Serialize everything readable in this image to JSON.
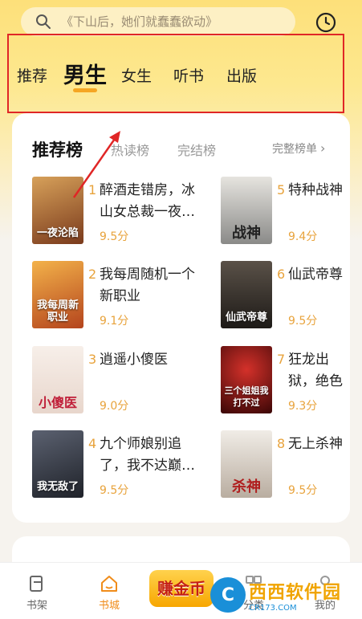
{
  "search": {
    "placeholder": "《下山后，她们就蠢蠢欲动》"
  },
  "tabs": [
    {
      "label": "推荐"
    },
    {
      "label": "男生"
    },
    {
      "label": "女生"
    },
    {
      "label": "听书"
    },
    {
      "label": "出版"
    }
  ],
  "active_tab": "男生",
  "rank": {
    "tabs": [
      {
        "label": "推荐榜"
      },
      {
        "label": "热读榜"
      },
      {
        "label": "完结榜"
      }
    ],
    "full_list": "完整榜单",
    "books": [
      {
        "rank": "1",
        "title": "醉酒走错房，冰山女总裁一夜…",
        "score": "9.5分",
        "cover_text": "一夜沦陷",
        "cover_color": "#7a3a1c"
      },
      {
        "rank": "2",
        "title": "我每周随机一个新职业",
        "score": "9.1分",
        "cover_text": "我每周新职业",
        "cover_color": "#d9772b"
      },
      {
        "rank": "3",
        "title": "逍遥小傻医",
        "score": "9.0分",
        "cover_text": "小傻医",
        "cover_color": "#efe6df"
      },
      {
        "rank": "4",
        "title": "九个师娘别追了，我不达巅…",
        "score": "9.5分",
        "cover_text": "我无敌了",
        "cover_color": "#3b3f4a"
      },
      {
        "rank": "5",
        "title": "特种战神",
        "score": "9.4分",
        "cover_text": "战神",
        "cover_color": "#8a8a88"
      },
      {
        "rank": "6",
        "title": "仙武帝尊",
        "score": "9.5分",
        "cover_text": "仙武帝尊",
        "cover_color": "#2a2723"
      },
      {
        "rank": "7",
        "title": "狂龙出狱，绝色嫂嫂…",
        "score": "9.3分",
        "cover_text": "三个姐姐我打不过",
        "cover_color": "#5e0d0d"
      },
      {
        "rank": "8",
        "title": "无上杀神",
        "score": "9.5分",
        "cover_text": "杀神",
        "cover_color": "#d8d2c8"
      }
    ]
  },
  "bottom_nav": {
    "bookshelf": "书架",
    "bookstore": "书城",
    "earn": "赚金币",
    "category": "分类",
    "mine": "我的"
  },
  "watermark": {
    "main": "西西软件园",
    "sub": "CR173.COM"
  },
  "colors": {
    "accent": "#f5a623",
    "highlight_box": "#e02626",
    "score": "#e8a33c"
  }
}
